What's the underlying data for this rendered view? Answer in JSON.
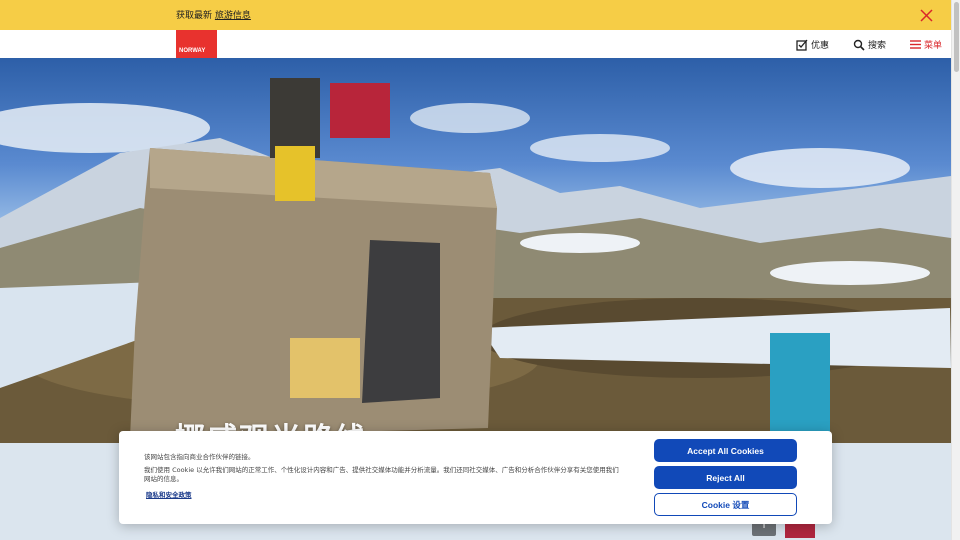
{
  "banner": {
    "prefix": "获取最新",
    "link": "旅游信息",
    "close_icon": "close-x-icon",
    "accent": "#f6cd46"
  },
  "header": {
    "logo_text": "NORWAY",
    "logo_color": "#e8322e",
    "nav": {
      "offers": "优惠",
      "search": "搜索",
      "menu": "菜单"
    }
  },
  "hero": {
    "title": "挪威观光路线",
    "info_label": "i"
  },
  "cookie": {
    "line1": "该网站包含指向商业合作伙伴的链接。",
    "line2": "我们使用 Cookie 以允许我们网站的正常工作、个性化设计内容和广告、提供社交媒体功能并分析流量。我们还同社交媒体、广告和分析合作伙伴分享有关您使用我们网站的信息。",
    "privacy_link": "隐私和安全政策",
    "accept": "Accept All Cookies",
    "reject": "Reject All",
    "settings": "Cookie 设置",
    "button_color": "#1149b8"
  }
}
